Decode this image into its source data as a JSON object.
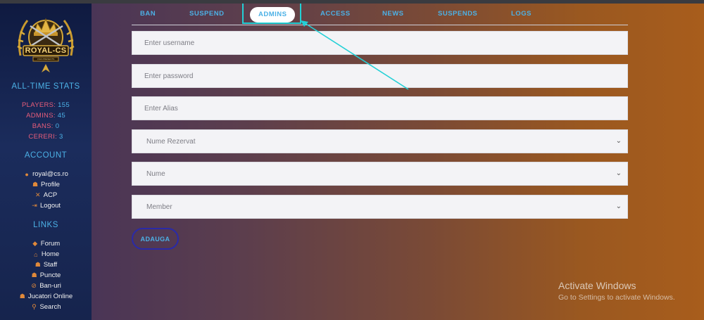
{
  "logo": {
    "name": "ROYAL-CS",
    "tagline": "CS16.PRESENTS"
  },
  "stats": {
    "title": "ALL-TIME STATS",
    "items": [
      {
        "label": "PLAYERS:",
        "value": "155"
      },
      {
        "label": "ADMINS:",
        "value": "45"
      },
      {
        "label": "BANS:",
        "value": "0"
      },
      {
        "label": "CERERI:",
        "value": "3"
      }
    ]
  },
  "account": {
    "title": "ACCOUNT",
    "items": [
      {
        "icon": "user-icon",
        "label": "royal@cs.ro"
      },
      {
        "icon": "profile-icon",
        "label": "Profile"
      },
      {
        "icon": "tools-icon",
        "label": "ACP"
      },
      {
        "icon": "logout-icon",
        "label": "Logout"
      }
    ]
  },
  "links": {
    "title": "LINKS",
    "items": [
      {
        "icon": "forum-icon",
        "label": "Forum"
      },
      {
        "icon": "home-icon",
        "label": "Home"
      },
      {
        "icon": "staff-icon",
        "label": "Staff"
      },
      {
        "icon": "points-icon",
        "label": "Puncte"
      },
      {
        "icon": "ban-icon",
        "label": "Ban-uri"
      },
      {
        "icon": "players-icon",
        "label": "Jucatori Online"
      },
      {
        "icon": "search-icon",
        "label": "Search"
      }
    ]
  },
  "tabs": [
    {
      "label": "BAN",
      "active": false
    },
    {
      "label": "SUSPEND",
      "active": false
    },
    {
      "label": "ADMINS",
      "active": true
    },
    {
      "label": "ACCESS",
      "active": false
    },
    {
      "label": "NEWS",
      "active": false
    },
    {
      "label": "SUSPENDS",
      "active": false
    },
    {
      "label": "LOGS",
      "active": false
    }
  ],
  "form": {
    "username_placeholder": "Enter username",
    "password_placeholder": "Enter password",
    "alias_placeholder": "Enter Alias",
    "reserved_name_selected": "Nume Rezervat",
    "name_selected": "Nume",
    "role_selected": "Member",
    "submit_label": "ADAUGA"
  },
  "windows_notice": {
    "title": "Activate Windows",
    "subtitle": "Go to Settings to activate Windows."
  },
  "colors": {
    "accent": "#4cb1e6",
    "stat_label": "#e85d7a",
    "highlight_box": "#22d0d6",
    "button_border": "#2a2aa8",
    "icon_orange": "#e0893a"
  }
}
